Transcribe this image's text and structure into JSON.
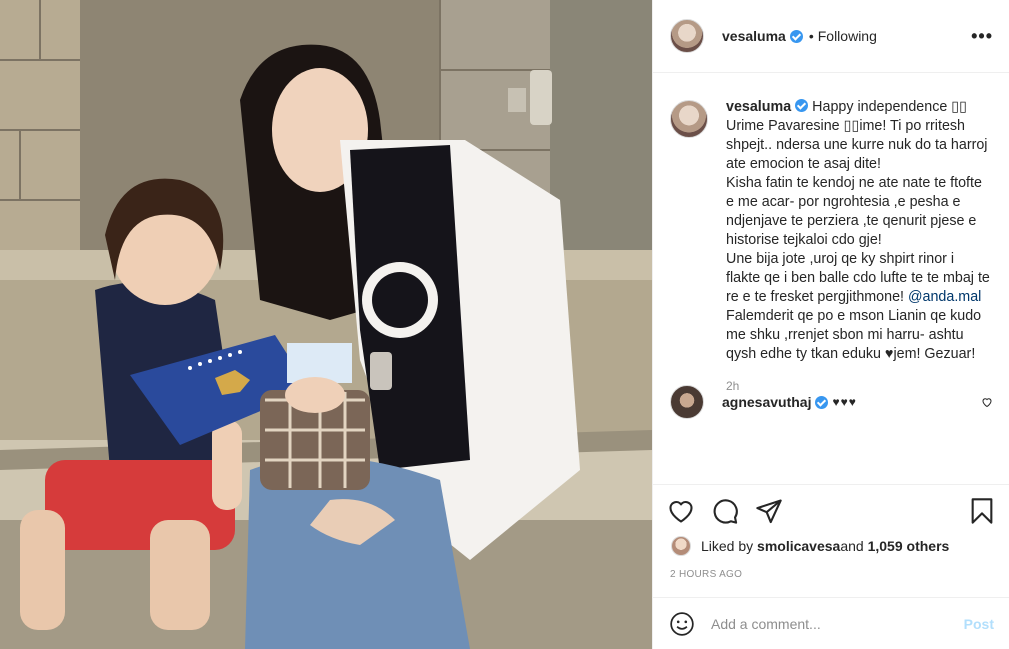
{
  "post": {
    "username": "vesaluma",
    "follow_dot": "•",
    "follow_status": "Following",
    "more_label": "•••"
  },
  "caption": {
    "username": "vesaluma",
    "text": "Happy independence ▯▯\nUrime Pavaresine ▯▯ime! Ti po rritesh shpejt.. ndersa une kurre nuk do ta harroj ate emocion te asaj dite!\nKisha fatin te kendoj ne ate nate te ftofte e me acar- por ngrohtesia ,e pesha e ndjenjave te perziera ,te qenurit pjese e historise tejkaloi cdo gje!\nUne bija jote ,uroj qe ky shpirt rinor i flakte qe i ben balle cdo lufte te te mbaj te re e te fresket pergjithmone!",
    "mention": "@anda.mal",
    "text_after_mention": " Falemderit qe po e mson Lianin qe kudo me shku ,rrenjet sbon mi harru- ashtu qysh edhe ty tkan eduku ♥jem! Gezuar!",
    "time": "2h"
  },
  "comment": {
    "username": "agnesavuthaj",
    "text": "♥♥♥"
  },
  "likes": {
    "prefix": "Liked by ",
    "user": "smolicavesa",
    "middle": " and ",
    "count": "1,059 others"
  },
  "timestamp": "2 HOURS AGO",
  "add_comment": {
    "placeholder": "Add a comment...",
    "post_label": "Post"
  },
  "icons": {
    "like": "heart-icon",
    "comment": "comment-icon",
    "share": "paper-plane-icon",
    "save": "bookmark-icon",
    "emoji": "smiley-icon"
  },
  "colors": {
    "verified": "#3897f0",
    "post_button": "#b2dffc",
    "mention": "#00376b"
  }
}
